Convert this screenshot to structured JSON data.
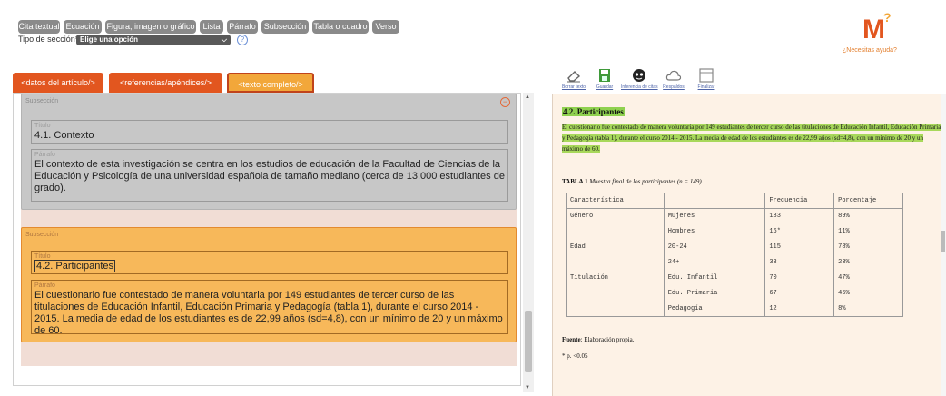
{
  "toolbar": {
    "buttons": [
      "Cita textual",
      "Ecuación",
      "Figura, imagen o gráfico",
      "Lista",
      "Párrafo",
      "Subsección",
      "Tabla o cuadro",
      "Verso"
    ],
    "section_type_label": "Tipo de sección*:",
    "section_type_value": "Elige una opción",
    "help_glyph": "?"
  },
  "brand": {
    "logo_text": "M",
    "logo_sup": "?",
    "help_link": "¿Necesitas ayuda?",
    "logo_color": "#e2561f",
    "logo_accent": "#f2a73a"
  },
  "tabs": [
    "<datos del artículo/>",
    "<referencias/apéndices/>",
    "<texto completo/>"
  ],
  "editor": {
    "cards": [
      {
        "label": "Subsección",
        "titulo_label": "Título",
        "titulo_value": "4.1. Contexto",
        "parrafo_label": "Párrafo",
        "parrafo_value": "El contexto de esta investigación se centra en los estudios de educación de la Facultad de Ciencias de la Educación y Psicología de una universidad española de tamaño mediano (cerca de 13.000 estudiantes de grado)."
      },
      {
        "label": "Subsección",
        "titulo_label": "Título",
        "titulo_value": "4.2. Participantes",
        "parrafo_label": "Párrafo",
        "parrafo_value": "El cuestionario fue contestado de manera voluntaria por 149 estudiantes de tercer curso de las titulaciones de Educación Infantil, Educación Primaria y Pedagogía (tabla 1), durante el curso 2014 - 2015. La media de edad de los estudiantes es de 22,99 años (sd=4,8), con un mínimo de 20 y un máximo de 60."
      }
    ],
    "remove_glyph": "−"
  },
  "right_tools": [
    {
      "icon": "eraser-icon",
      "label": "Borrar texto"
    },
    {
      "icon": "save-icon",
      "label": "Guardar"
    },
    {
      "icon": "citation-icon",
      "label": "Inferencia de citas"
    },
    {
      "icon": "cloud-icon",
      "label": "Respaldos"
    },
    {
      "icon": "finish-icon",
      "label": "Finalizar"
    }
  ],
  "preview": {
    "heading": "4.2. Participantes",
    "paragraph": "El cuestionario fue contestado de manera voluntaria por 149 estudiantes de tercer curso de las titulaciones de Educación Infantil, Educación Primaria y Pedagogía (tabla 1), durante el curso 2014 - 2015. La media de edad de los estudiantes es de 22,99 años (sd=4,8), con un mínimo de 20 y un máximo de 60.",
    "table_label": "TABLA 1",
    "table_caption": "Muestra final de los participantes (n = 149)",
    "table_headers": [
      "Característica",
      "",
      "Frecuencia",
      "Porcentaje"
    ],
    "table_rows": [
      [
        "Género",
        "Mujeres",
        "133",
        "89%"
      ],
      [
        "",
        "Hombres",
        "16*",
        "11%"
      ],
      [
        "Edad",
        "20-24",
        "115",
        "78%"
      ],
      [
        "",
        "24+",
        "33",
        "23%"
      ],
      [
        "Titulación",
        "Edu. Infantil",
        "70",
        "47%"
      ],
      [
        "",
        "Edu. Primaria",
        "67",
        "45%"
      ],
      [
        "",
        "Pedagogía",
        "12",
        "8%"
      ]
    ],
    "fuente_label": "Fuente",
    "fuente_text": ": Elaboración propia.",
    "note": "* p. <0.05"
  },
  "colors": {
    "accent_orange": "#e2561f",
    "active_tab": "#f2a73a",
    "highlight_green": "#a8d85b"
  }
}
